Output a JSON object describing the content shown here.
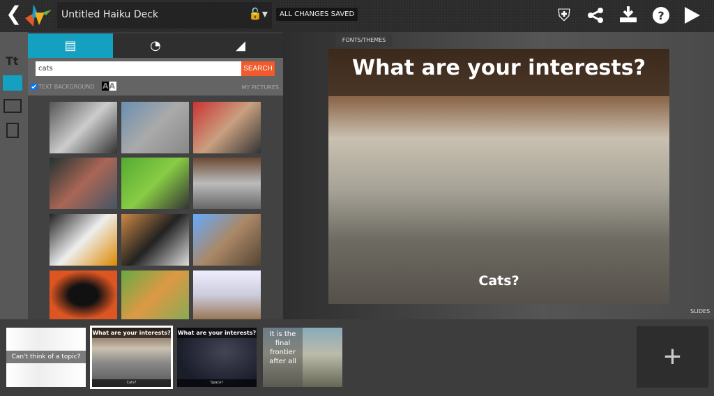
{
  "header": {
    "title": "Untitled Haiku Deck",
    "save_status": "ALL CHANGES SAVED",
    "icons": [
      "back-icon",
      "logo",
      "lock-icon",
      "shield-icon",
      "share-icon",
      "download-icon",
      "help-icon",
      "play-icon"
    ]
  },
  "sidebar": {
    "items": [
      {
        "icon": "Tt",
        "name": "text"
      },
      {
        "name": "images",
        "active": true
      },
      {
        "name": "layout"
      },
      {
        "name": "notes"
      }
    ]
  },
  "panel": {
    "tabs": [
      "images",
      "charts",
      "background"
    ],
    "search_value": "cats",
    "search_label": "SEARCH",
    "text_background_label": "TEXT BACKGROUND",
    "text_background_checked": true,
    "aa_label": "AA",
    "my_pictures_label": "MY PICTURES",
    "accent": "#14a0c0",
    "search_color": "#f05a2c"
  },
  "editor": {
    "fonts_themes": "FONTS/THEMES",
    "slide_title": "What are your interests?",
    "slide_caption": "Cats?",
    "slides_label": "SLIDES"
  },
  "slides": [
    {
      "caption": "Can't think of a topic?"
    },
    {
      "title": "What are your interests?",
      "caption": "Cats?",
      "selected": true
    },
    {
      "title": "What are your interests?",
      "caption": "Space?"
    },
    {
      "text": "It is the final frontier after all"
    }
  ],
  "add_label": "+"
}
